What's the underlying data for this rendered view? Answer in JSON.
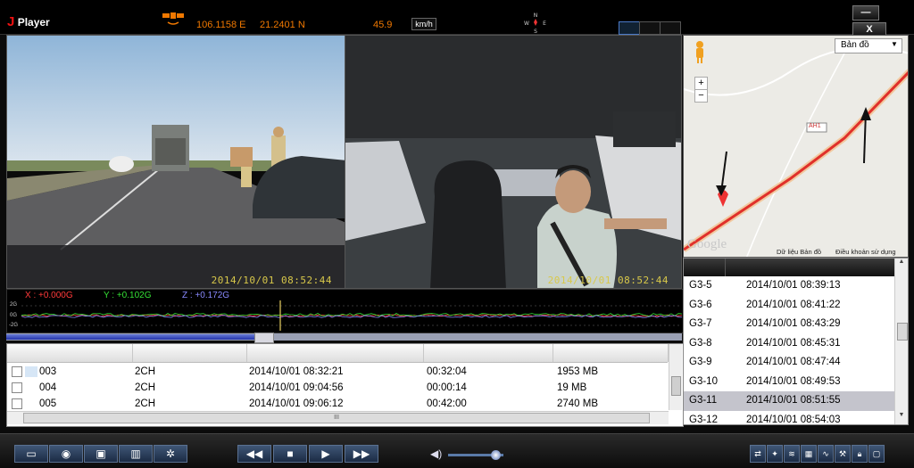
{
  "app": {
    "logo_letter": "J",
    "title": "Player"
  },
  "gps": {
    "longitude": "106.1158 E",
    "latitude": "21.2401 N",
    "speed": "45.9",
    "speed_unit": "km/h"
  },
  "window": {
    "minimize": "—",
    "close": "X"
  },
  "video": {
    "timestamp_left": "2014/10/01   08:52:44",
    "timestamp_right": "2014/10/01   08:52:44"
  },
  "gsensor": {
    "x": "X : +0.000G",
    "y": "Y : +0.102G",
    "z": "Z : +0.172G",
    "axis_top": "2G",
    "axis_mid": "0G",
    "axis_bottom": "-2G"
  },
  "seek": {
    "progress": 0.38
  },
  "files": [
    {
      "name": "003",
      "channel": "2CH",
      "start": "2014/10/01 08:32:21",
      "duration": "00:32:04",
      "size": "1953 MB"
    },
    {
      "name": "004",
      "channel": "2CH",
      "start": "2014/10/01 09:04:56",
      "duration": "00:00:14",
      "size": "19 MB"
    },
    {
      "name": "005",
      "channel": "2CH",
      "start": "2014/10/01 09:06:12",
      "duration": "00:42:00",
      "size": "2740 MB"
    }
  ],
  "file_scroll": "III",
  "map": {
    "type_selected": "Bản đồ",
    "zoom_in": "+",
    "zoom_out": "−",
    "road_label": "AH1",
    "watermark": "Google",
    "map_data": "Dữ liệu Bản đồ",
    "terms": "Điều khoản sử dụng"
  },
  "events": [
    {
      "id": "G3-5",
      "time": "2014/10/01  08:39:13"
    },
    {
      "id": "G3-6",
      "time": "2014/10/01  08:41:22"
    },
    {
      "id": "G3-7",
      "time": "2014/10/01  08:43:29"
    },
    {
      "id": "G3-8",
      "time": "2014/10/01  08:45:31"
    },
    {
      "id": "G3-9",
      "time": "2014/10/01  08:47:44"
    },
    {
      "id": "G3-10",
      "time": "2014/10/01  08:49:53"
    },
    {
      "id": "G3-11",
      "time": "2014/10/01  08:51:55"
    },
    {
      "id": "G3-12",
      "time": "2014/10/01  08:54:03"
    }
  ],
  "selected_event": "G3-11",
  "controls": {
    "rewind": "◀◀",
    "stop": "■",
    "play": "▶",
    "forward": "▶▶",
    "volume_level": 0.85
  },
  "icons": [
    "folder-icon",
    "camera-icon",
    "save-icon",
    "trash-icon",
    "gear-icon",
    "volume-icon",
    "network-icon",
    "gps-icon",
    "road-icon",
    "map-icon",
    "wave-icon",
    "wrench-icon",
    "lock-icon",
    "window-icon"
  ],
  "colors": {
    "accent_orange": "#f07800",
    "gx": "#ff3a3a",
    "gy": "#35e035",
    "gz": "#8a8aff",
    "stamp": "#d8c84a",
    "route": "#e0302a"
  }
}
